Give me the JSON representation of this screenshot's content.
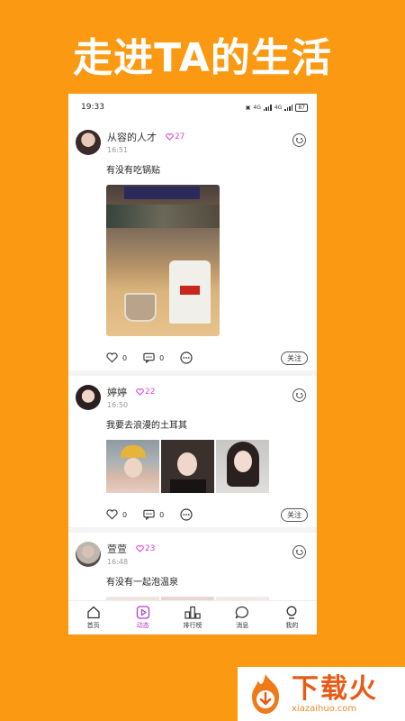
{
  "banner": {
    "title": "走进TA的生活"
  },
  "status_bar": {
    "time": "19:33",
    "battery": "87",
    "net1": "4G",
    "net2": "4G"
  },
  "posts": [
    {
      "name": "从容的人才",
      "fans": "27",
      "time": "16:51",
      "text": "有没有吃锅贴",
      "likes": "0",
      "comments": "0",
      "follow": "关注"
    },
    {
      "name": "婷婷",
      "fans": "22",
      "time": "16:50",
      "text": "我要去浪漫的土耳其",
      "likes": "0",
      "comments": "0",
      "follow": "关注"
    },
    {
      "name": "萱萱",
      "fans": "23",
      "time": "16:48",
      "text": "有没有一起泡温泉"
    }
  ],
  "tabbar": {
    "items": [
      {
        "label": "首页",
        "icon": "home-icon"
      },
      {
        "label": "动态",
        "icon": "play-icon"
      },
      {
        "label": "排行榜",
        "icon": "rank-icon"
      },
      {
        "label": "消息",
        "icon": "message-icon"
      },
      {
        "label": "我的",
        "icon": "profile-icon"
      }
    ],
    "active_color": "#b33ad6"
  },
  "watermark": {
    "name": "下载火",
    "url": "xiazaihuo.com"
  },
  "colors": {
    "background": "#fb9a12",
    "fans": "#d94ad0"
  }
}
